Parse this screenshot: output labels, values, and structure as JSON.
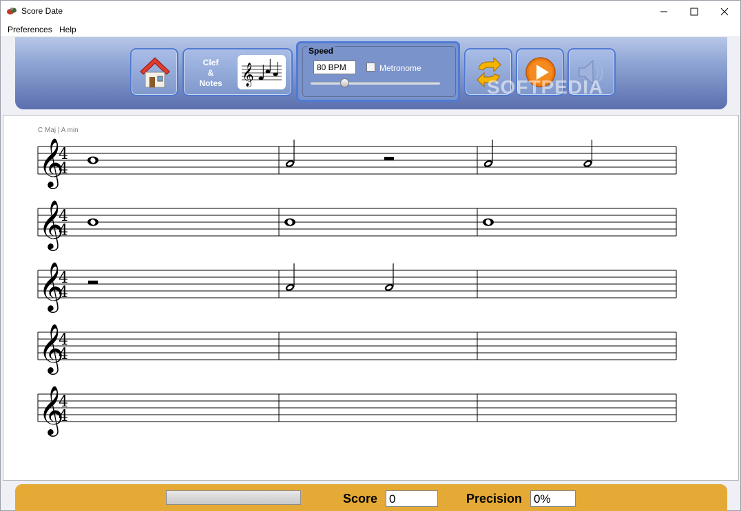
{
  "window": {
    "title": "Score Date"
  },
  "menu": {
    "items": [
      "Preferences",
      "Help"
    ]
  },
  "toolbar": {
    "clef_label_line1": "Clef",
    "clef_label_line2": "&",
    "clef_label_line3": "Notes",
    "speed_title": "Speed",
    "bpm_value": "80 BPM",
    "metronome_label": "Metronome",
    "metronome_checked": false,
    "speed_level": 0.26,
    "icons": [
      "home-icon",
      "clef-notes-icon",
      "repeat-icon",
      "play-icon",
      "speaker-icon"
    ]
  },
  "watermark": "SOFTPEDIA",
  "score": {
    "key_label": "C Maj | A min",
    "time_signature": "4/4",
    "staves": [
      {
        "measures": [
          [
            "whole"
          ],
          [
            "half",
            "half-rest"
          ],
          [
            "half",
            "half"
          ]
        ]
      },
      {
        "measures": [
          [
            "whole"
          ],
          [
            "whole"
          ],
          [
            "whole"
          ]
        ]
      },
      {
        "measures": [
          [
            "half-rest"
          ],
          [
            "half",
            "half"
          ],
          []
        ]
      },
      {
        "measures": [
          [],
          [],
          []
        ]
      },
      {
        "measures": [
          [],
          [],
          []
        ]
      }
    ]
  },
  "status": {
    "progress": 0,
    "score_label": "Score",
    "score_value": "0",
    "precision_label": "Precision",
    "precision_value": "0%"
  },
  "colors": {
    "toolbar": "#5b6fae",
    "bottombar": "#e5aa35",
    "button_border": "#4f78d0"
  }
}
